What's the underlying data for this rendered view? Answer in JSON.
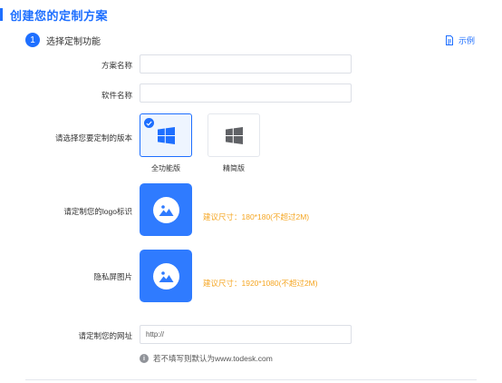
{
  "page": {
    "title": "创建您的定制方案"
  },
  "step": {
    "number": "1",
    "label": "选择定制功能"
  },
  "example_link": {
    "label": "示例"
  },
  "form": {
    "plan_name": {
      "label": "方案名称",
      "value": "",
      "placeholder": ""
    },
    "software_name": {
      "label": "软件名称",
      "value": "",
      "placeholder": ""
    },
    "version": {
      "label": "请选择您要定制的版本",
      "options": [
        {
          "label": "全功能版",
          "selected": true
        },
        {
          "label": "精简版",
          "selected": false
        }
      ]
    },
    "logo": {
      "label": "请定制您的logo标识",
      "hint": "建议尺寸：180*180(不超过2M)"
    },
    "privacy_screen": {
      "label": "隐私屏图片",
      "hint": "建议尺寸：1920*1080(不超过2M)"
    },
    "website": {
      "label": "请定制您的网址",
      "value": "http://",
      "info": "若不填写则默认为www.todesk.com"
    }
  },
  "colors": {
    "accent": "#1e6fff",
    "upload_bg": "#2f7bff",
    "hint": "#f5a623",
    "windows_selected": "#1e6fff",
    "windows_unselected": "#606266"
  },
  "icons": {
    "example": "document-icon",
    "windows": "windows-logo-icon",
    "check": "check-icon",
    "upload": "image-upload-icon",
    "info": "info-icon"
  }
}
